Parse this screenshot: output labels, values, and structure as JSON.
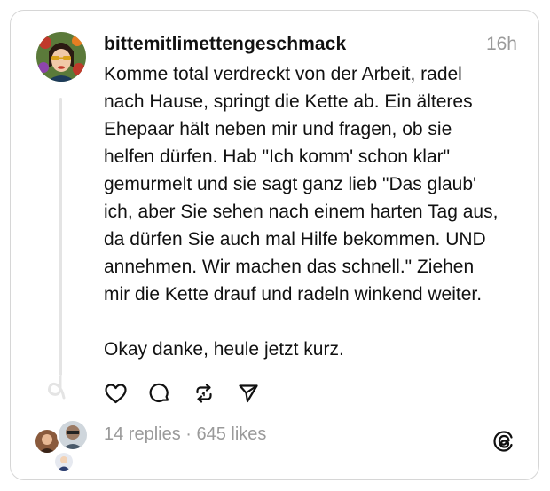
{
  "post": {
    "username": "bittemitlimettengeschmack",
    "timestamp": "16h",
    "text": "Komme total verdreckt von der Arbeit, radel\nnach Hause, springt die Kette ab. Ein älteres\nEhepaar hält neben mir und fragen, ob sie\nhelfen dürfen. Hab \"Ich komm' schon klar\"\ngemurmelt und sie sagt ganz lieb \"Das glaub'\nich, aber Sie sehen nach einem harten Tag aus,\nda dürfen Sie auch mal Hilfe bekommen. UND\nannehmen. Wir machen das schnell.\" Ziehen\nmir die Kette drauf und radeln winkend weiter.\n\nOkay danke, heule jetzt kurz.",
    "stats": "14 replies · 645 likes"
  },
  "icons": {
    "like": "heart-icon",
    "reply": "speech-bubble-icon",
    "repost": "repost-icon",
    "share": "send-icon",
    "brand": "threads-logo-icon"
  },
  "colors": {
    "text": "#111111",
    "muted": "#9a9a9a",
    "border": "#d6d6d6"
  }
}
